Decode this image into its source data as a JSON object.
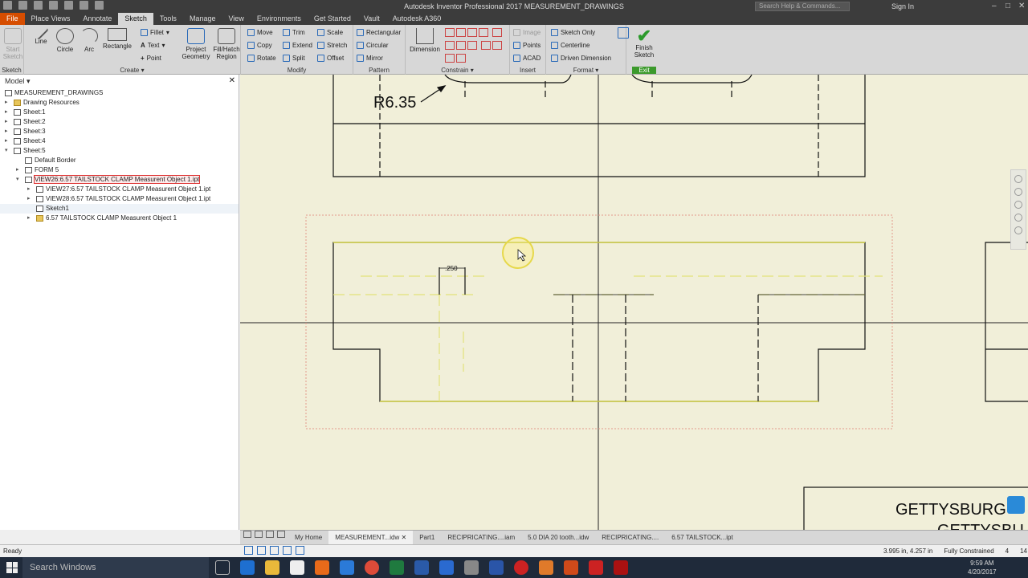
{
  "window": {
    "title": "Autodesk Inventor Professional 2017   MEASUREMENT_DRAWINGS",
    "search_placeholder": "Search Help & Commands...",
    "sign_in": "Sign In"
  },
  "ribbon_tabs": [
    "File",
    "Place Views",
    "Annotate",
    "Sketch",
    "Tools",
    "Manage",
    "View",
    "Environments",
    "Get Started",
    "Vault",
    "Autodesk A360"
  ],
  "active_tab": "Sketch",
  "ribbon": {
    "sketch_group": {
      "start_sketch": "Start Sketch",
      "label": "Sketch"
    },
    "create_group": {
      "line": "Line",
      "circle": "Circle",
      "arc": "Arc",
      "rectangle": "Rectangle",
      "fillet": "Fillet",
      "text": "Text",
      "point": "Point",
      "project_geometry": "Project Geometry",
      "fill_hatch": "Fill/Hatch Region",
      "label": "Create"
    },
    "modify_group": {
      "move": "Move",
      "copy": "Copy",
      "rotate": "Rotate",
      "trim": "Trim",
      "extend": "Extend",
      "split": "Split",
      "scale": "Scale",
      "stretch": "Stretch",
      "offset": "Offset",
      "label": "Modify"
    },
    "pattern_group": {
      "rectangular": "Rectangular",
      "circular": "Circular",
      "mirror": "Mirror",
      "label": "Pattern"
    },
    "constrain_group": {
      "dimension": "Dimension",
      "label": "Constrain"
    },
    "insert_group": {
      "image": "Image",
      "points": "Points",
      "acad": "ACAD",
      "label": "Insert"
    },
    "format_group": {
      "sketch_only": "Sketch Only",
      "centerline": "Centerline",
      "driven_dimension": "Driven Dimension",
      "label": "Format"
    },
    "exit_group": {
      "finish_sketch": "Finish Sketch",
      "label": "Exit"
    }
  },
  "model_browser": {
    "header": "Model",
    "items": [
      {
        "label": "MEASUREMENT_DRAWINGS",
        "indent": 0
      },
      {
        "label": "Drawing Resources",
        "indent": 1
      },
      {
        "label": "Sheet:1",
        "indent": 1
      },
      {
        "label": "Sheet:2",
        "indent": 1
      },
      {
        "label": "Sheet:3",
        "indent": 1
      },
      {
        "label": "Sheet:4",
        "indent": 1
      },
      {
        "label": "Sheet:5",
        "indent": 1
      },
      {
        "label": "Default Border",
        "indent": 2
      },
      {
        "label": "FORM 5",
        "indent": 2
      },
      {
        "label": "VIEW26:6.57 TAILSTOCK CLAMP Measurent Object 1.ipt",
        "indent": 2
      },
      {
        "label": "VIEW27:6.57 TAILSTOCK CLAMP Measurent Object 1.ipt",
        "indent": 3
      },
      {
        "label": "VIEW28:6.57 TAILSTOCK CLAMP Measurent Object 1.ipt",
        "indent": 3
      },
      {
        "label": "Sketch1",
        "indent": 3
      },
      {
        "label": "6.57 TAILSTOCK CLAMP Measurent Object 1",
        "indent": 3
      }
    ]
  },
  "drawing": {
    "radius_label": "R6.35",
    "dimension_label": ".250",
    "title_block_line1": "GETTYSBURG",
    "title_block_line2": "GETTYSBU"
  },
  "document_tabs": [
    "My Home",
    "MEASUREMENT...idw",
    "Part1",
    "RECIPRICATING....iam",
    "5.0 DIA 20 tooth...idw",
    "RECIPRICATING....",
    "6.57 TAILSTOCK...ipt"
  ],
  "status": {
    "left": "Ready",
    "coords": "3.995 in, 4.257 in",
    "constraint": "Fully Constrained",
    "num1": "4",
    "num2": "14"
  },
  "taskbar": {
    "search": "Search Windows",
    "time": "9:59 AM",
    "date": "4/20/2017"
  }
}
